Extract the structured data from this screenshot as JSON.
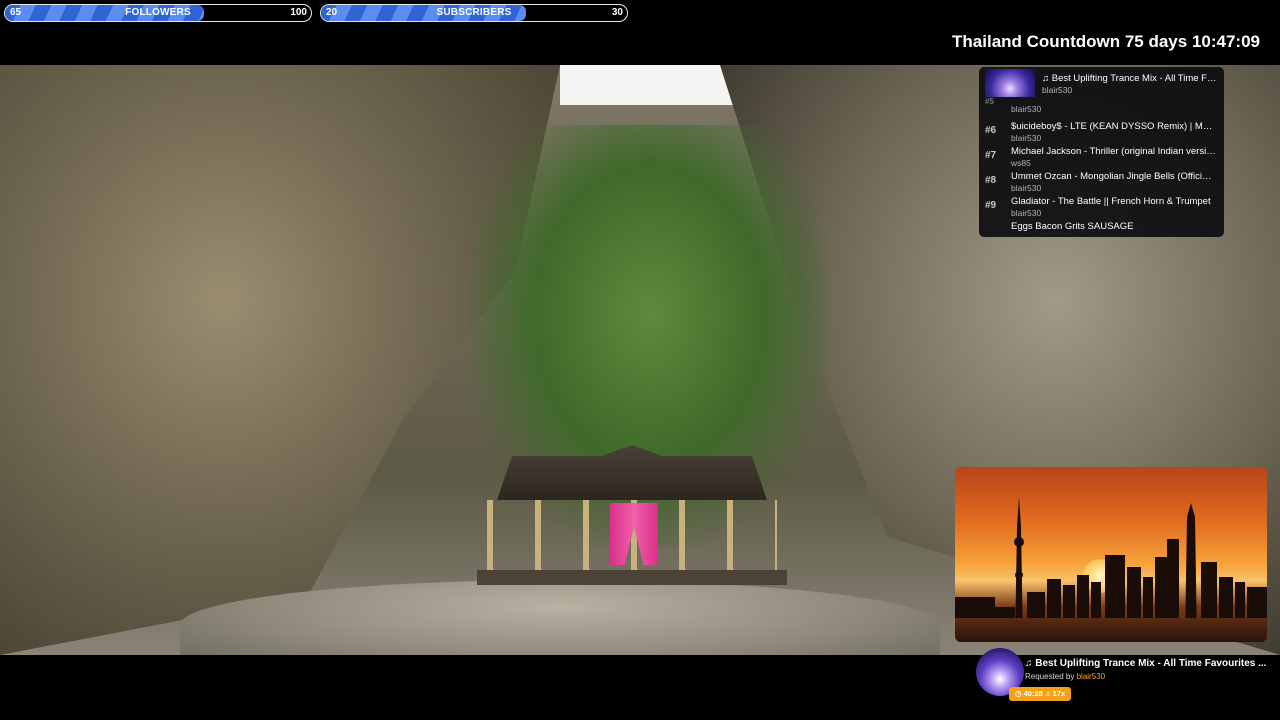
{
  "followers_bar": {
    "current": "65",
    "label": "FOLLOWERS",
    "goal": "100",
    "progress": 0.65
  },
  "subscribers_bar": {
    "current": "20",
    "label": "SUBSCRIBERS",
    "goal": "30",
    "progress": 0.67
  },
  "countdown": "Thailand Countdown 75 days 10:47:09",
  "playlist": {
    "now": {
      "title": "♫ Best Uplifting Trance Mix - All Time Favourites",
      "user": "blair530"
    },
    "partial_top": {
      "number": "#5",
      "user": "blair530"
    },
    "requests": [
      {
        "number": "#6",
        "title": "$uicideboy$ - LTE (KEAN DYSSO Remix) | Music Video",
        "user": "blair530"
      },
      {
        "number": "#7",
        "title": "Michael Jackson - Thriller (original Indian version)",
        "user": "ws85"
      },
      {
        "number": "#8",
        "title": "Ummet Ozcan - Mongolian Jingle Bells (Official Video)",
        "user": "blair530"
      },
      {
        "number": "#9",
        "title": "Gladiator - The Battle || French Horn & Trumpet",
        "user": "blair530"
      }
    ],
    "partial_bottom": {
      "title": "Eggs Bacon Grits SAUSAGE"
    }
  },
  "now_playing": {
    "title": "♫ Best Uplifting Trance Mix - All Time Favourites ...",
    "requested_prefix": "Requested by ",
    "requested_user": "blair530",
    "badge": "◷ 40:28  ♫ 17x"
  },
  "colors": {
    "bar_fill": "#2f63d6",
    "accent_orange": "#f5a623"
  }
}
